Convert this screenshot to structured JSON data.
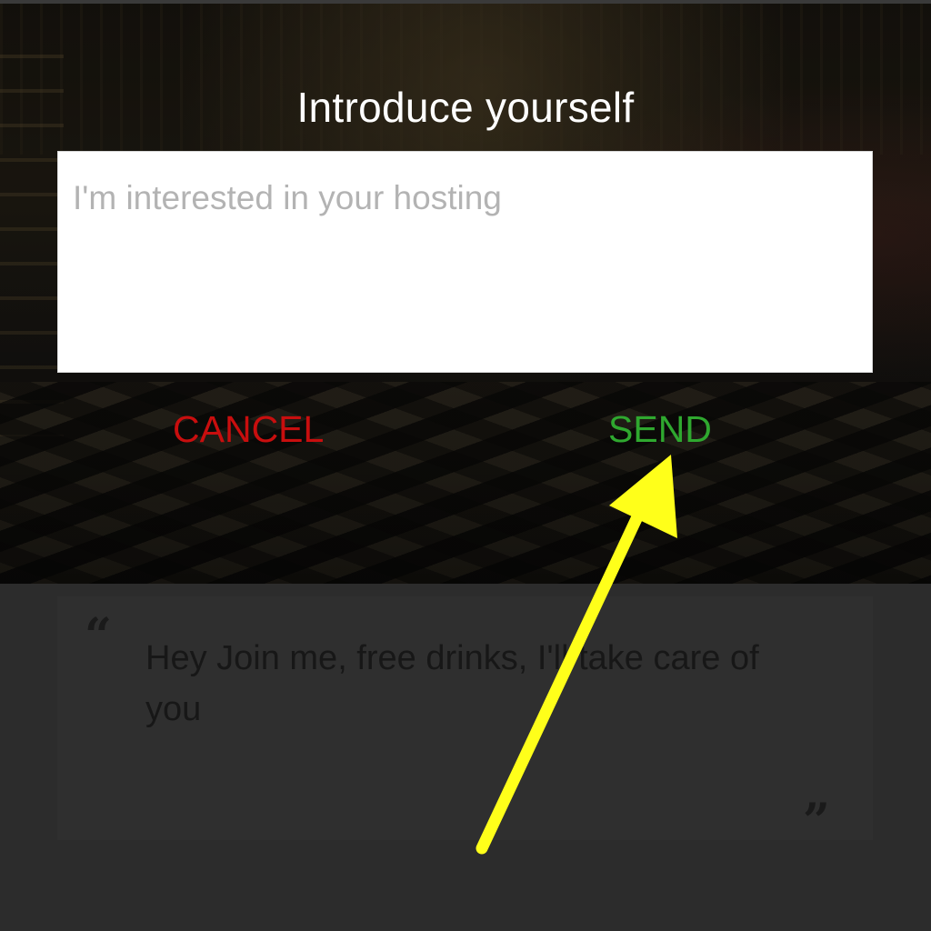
{
  "dialog": {
    "title": "Introduce yourself",
    "message_placeholder": "I'm interested in your hosting",
    "cancel_label": "CANCEL",
    "send_label": "SEND"
  },
  "quote": {
    "open_mark": "“",
    "text": "Hey Join me, free drinks, I'll take care of you",
    "close_mark": "”"
  },
  "annotation": {
    "arrow_color": "#ffff1a",
    "arrow_target": "send-button"
  },
  "colors": {
    "cancel": "#c80e0e",
    "send": "#2fa82f",
    "panel": "#2f2f2f"
  }
}
